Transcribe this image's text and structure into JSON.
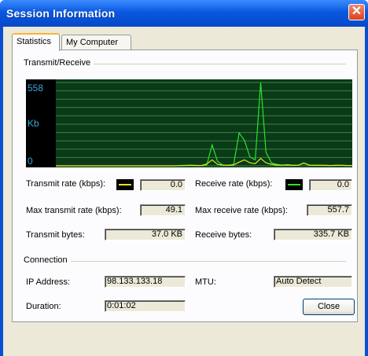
{
  "window": {
    "title": "Session Information",
    "close_glyph": "✕"
  },
  "tabs": [
    {
      "label": "Statistics",
      "active": true
    },
    {
      "label": "My Computer",
      "active": false
    }
  ],
  "transmit_receive": {
    "group_label": "Transmit/Receive",
    "graph": {
      "y_max_label": "558",
      "unit_label": "Kb",
      "y_min_label": "0",
      "receive_color": "#2ee02e",
      "transmit_color": "#e8e01e",
      "receive_series": [
        0,
        0,
        0,
        0,
        0,
        0,
        0,
        0,
        0,
        0,
        0,
        0,
        0,
        0,
        0,
        0,
        0,
        0,
        0,
        0,
        0,
        0,
        0,
        2,
        3,
        4,
        3,
        2,
        5,
        140,
        30,
        5,
        3,
        10,
        220,
        170,
        60,
        40,
        557,
        90,
        20,
        10,
        5,
        8,
        3,
        4,
        20,
        5,
        4,
        3,
        3,
        2,
        3,
        3,
        2,
        2
      ],
      "transmit_series": [
        0,
        0,
        0,
        0,
        0,
        0,
        0,
        0,
        0,
        0,
        0,
        0,
        0,
        0,
        0,
        0,
        0,
        0,
        0,
        0,
        0,
        0,
        0,
        1,
        2,
        3,
        2,
        2,
        12,
        40,
        10,
        5,
        3,
        6,
        25,
        40,
        20,
        15,
        49,
        20,
        10,
        5,
        4,
        6,
        3,
        4,
        18,
        4,
        3,
        3,
        3,
        2,
        3,
        3,
        2,
        2
      ]
    },
    "transmit_rate_label": "Transmit rate (kbps):",
    "transmit_rate_value": "0.0",
    "receive_rate_label": "Receive rate (kbps):",
    "receive_rate_value": "0.0",
    "max_transmit_label": "Max transmit rate (kbps):",
    "max_transmit_value": "49.1",
    "max_receive_label": "Max receive rate (kbps):",
    "max_receive_value": "557.7",
    "transmit_bytes_label": "Transmit bytes:",
    "transmit_bytes_value": "37.0 KB",
    "receive_bytes_label": "Receive bytes:",
    "receive_bytes_value": "335.7 KB"
  },
  "connection": {
    "group_label": "Connection",
    "ip_label": "IP Address:",
    "ip_value": "98.133.133.18",
    "mtu_label": "MTU:",
    "mtu_value": "Auto Detect",
    "duration_label": "Duration:",
    "duration_value": "0:01:02"
  },
  "buttons": {
    "close_label": "Close"
  }
}
